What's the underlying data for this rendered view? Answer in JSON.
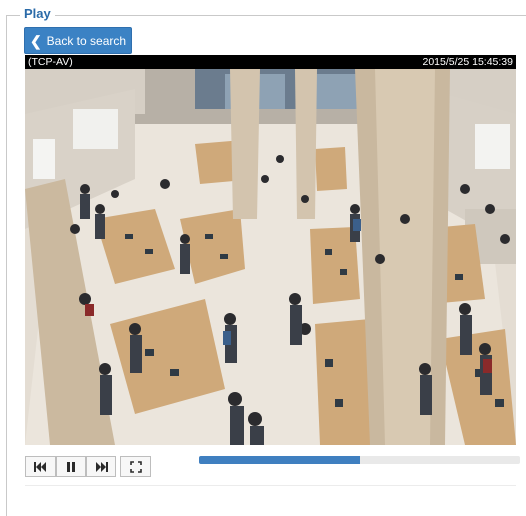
{
  "panel": {
    "title": "Play"
  },
  "back_button": {
    "label": "Back to search"
  },
  "video": {
    "source": "(TCP-AV)",
    "timestamp": "2015/5/25 15:45:39"
  },
  "controls": {
    "buttons": [
      "skip-previous-icon",
      "pause-icon",
      "skip-next-icon",
      "fullscreen-icon"
    ],
    "progress": 0.5
  },
  "colors": {
    "accent": "#3b82c4",
    "title": "#2a6aa8",
    "progress": "#3f7fc0"
  }
}
